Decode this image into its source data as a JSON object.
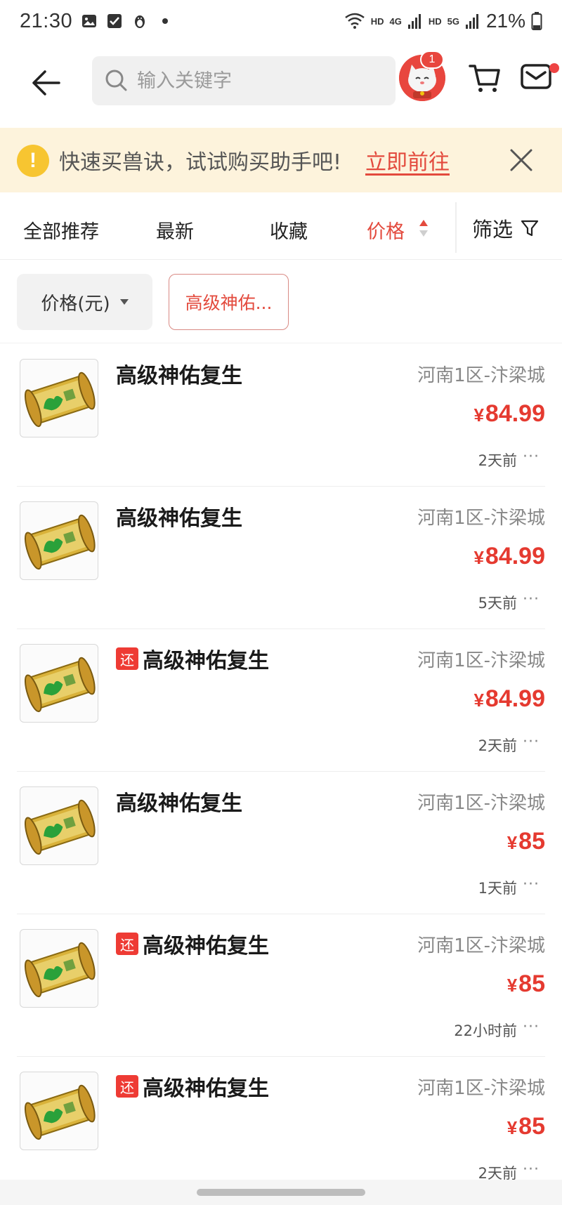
{
  "status_bar": {
    "time": "21:30",
    "network_hd1": "HD",
    "network_4g": "4G",
    "network_hd2": "HD",
    "network_5g": "5G",
    "battery": "21%"
  },
  "header": {
    "search_placeholder": "输入关键字",
    "avatar_badge": "1"
  },
  "notice": {
    "icon": "!",
    "text": "快速买兽诀，试试购买助手吧!",
    "link": "立即前往"
  },
  "sort_tabs": {
    "recommend": "全部推荐",
    "newest": "最新",
    "favorites": "收藏",
    "price": "价格",
    "filter": "筛选"
  },
  "filter_chips": {
    "price": "价格(元)",
    "keyword": "高级神佑..."
  },
  "items": [
    {
      "tag": "",
      "title": "高级神佑复生",
      "server": "河南1区-汴梁城",
      "currency": "¥",
      "price": "84.99",
      "time": "2天前"
    },
    {
      "tag": "",
      "title": "高级神佑复生",
      "server": "河南1区-汴梁城",
      "currency": "¥",
      "price": "84.99",
      "time": "5天前"
    },
    {
      "tag": "还",
      "title": "高级神佑复生",
      "server": "河南1区-汴梁城",
      "currency": "¥",
      "price": "84.99",
      "time": "2天前"
    },
    {
      "tag": "",
      "title": "高级神佑复生",
      "server": "河南1区-汴梁城",
      "currency": "¥",
      "price": "85",
      "time": "1天前"
    },
    {
      "tag": "还",
      "title": "高级神佑复生",
      "server": "河南1区-汴梁城",
      "currency": "¥",
      "price": "85",
      "time": "22小时前"
    },
    {
      "tag": "还",
      "title": "高级神佑复生",
      "server": "河南1区-汴梁城",
      "currency": "¥",
      "price": "85",
      "time": "2天前"
    }
  ],
  "more_label": "···",
  "colors": {
    "accent": "#e34a3d",
    "price": "#e53a30",
    "notice_bg": "#fdf3dc",
    "notice_icon": "#f7c531"
  }
}
